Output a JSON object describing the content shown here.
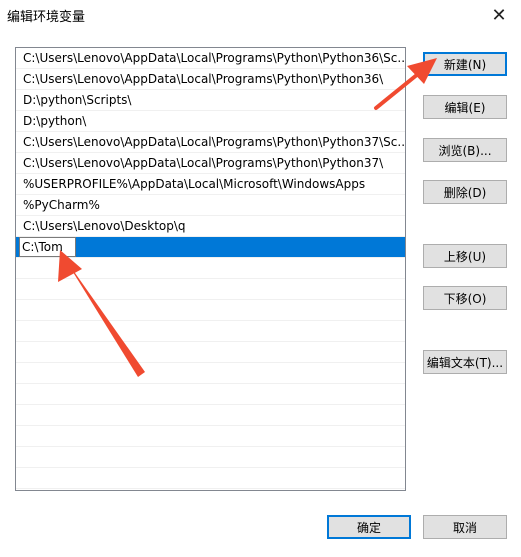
{
  "window": {
    "title": "编辑环境变量",
    "close_glyph": "✕"
  },
  "paths": [
    "C:\\Users\\Lenovo\\AppData\\Local\\Programs\\Python\\Python36\\Sc...",
    "C:\\Users\\Lenovo\\AppData\\Local\\Programs\\Python\\Python36\\",
    "D:\\python\\Scripts\\",
    "D:\\python\\",
    "C:\\Users\\Lenovo\\AppData\\Local\\Programs\\Python\\Python37\\Sc...",
    "C:\\Users\\Lenovo\\AppData\\Local\\Programs\\Python\\Python37\\",
    "%USERPROFILE%\\AppData\\Local\\Microsoft\\WindowsApps",
    "%PyCharm%",
    "C:\\Users\\Lenovo\\Desktop\\q"
  ],
  "editing_value": "C:\\Tom",
  "buttons": {
    "new": "新建(N)",
    "edit": "编辑(E)",
    "browse": "浏览(B)...",
    "delete": "删除(D)",
    "move_up": "上移(U)",
    "move_down": "下移(O)",
    "edit_text": "编辑文本(T)...",
    "ok": "确定",
    "cancel": "取消"
  },
  "colors": {
    "selection": "#0078d7",
    "annotation_arrow": "#f04a30"
  }
}
